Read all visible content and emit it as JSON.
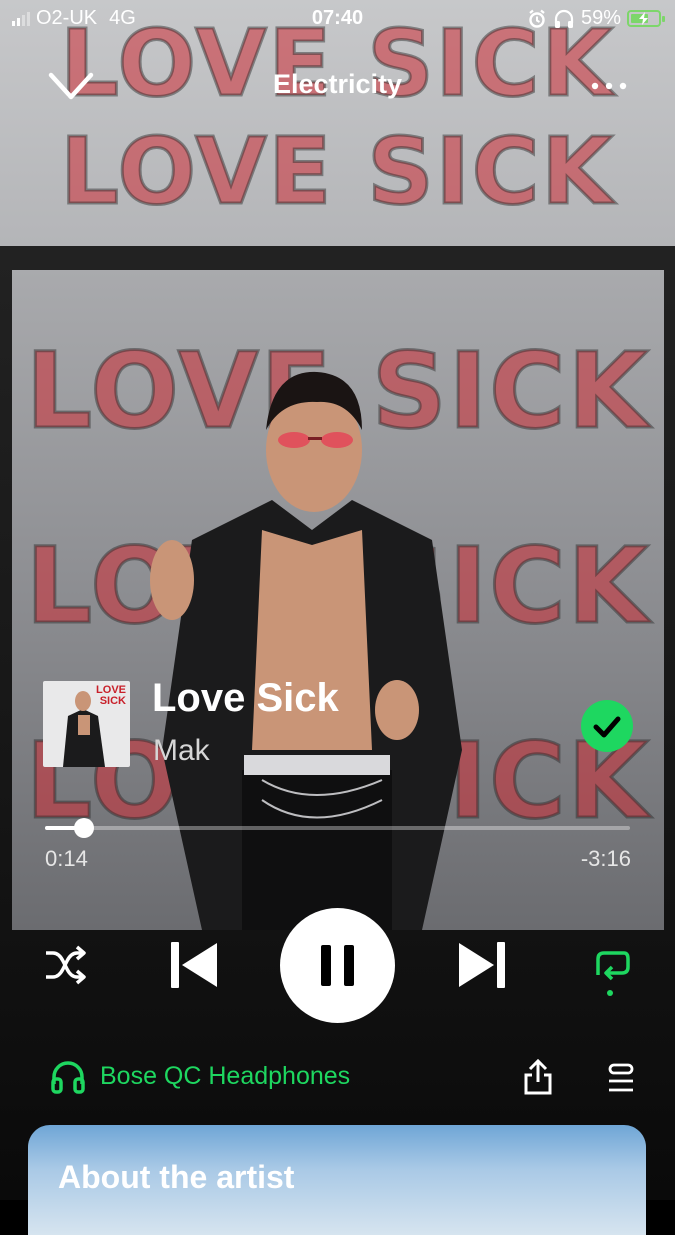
{
  "status_bar": {
    "carrier": "O2-UK",
    "network": "4G",
    "time": "07:40",
    "battery": "59%"
  },
  "header": {
    "title": "Electricity"
  },
  "album_art": {
    "text": "LOVE SICK",
    "thumb_text_line1": "LOVE",
    "thumb_text_line2": "SICK"
  },
  "track": {
    "title": "Love Sick",
    "artist": "Mak",
    "liked": true
  },
  "playback": {
    "elapsed": "0:14",
    "remaining": "-3:16",
    "progress_fraction": 0.067
  },
  "device": {
    "name": "Bose QC Headphones"
  },
  "about": {
    "title": "About the artist"
  },
  "colors": {
    "accent": "#1ed760",
    "background": "#121212"
  }
}
